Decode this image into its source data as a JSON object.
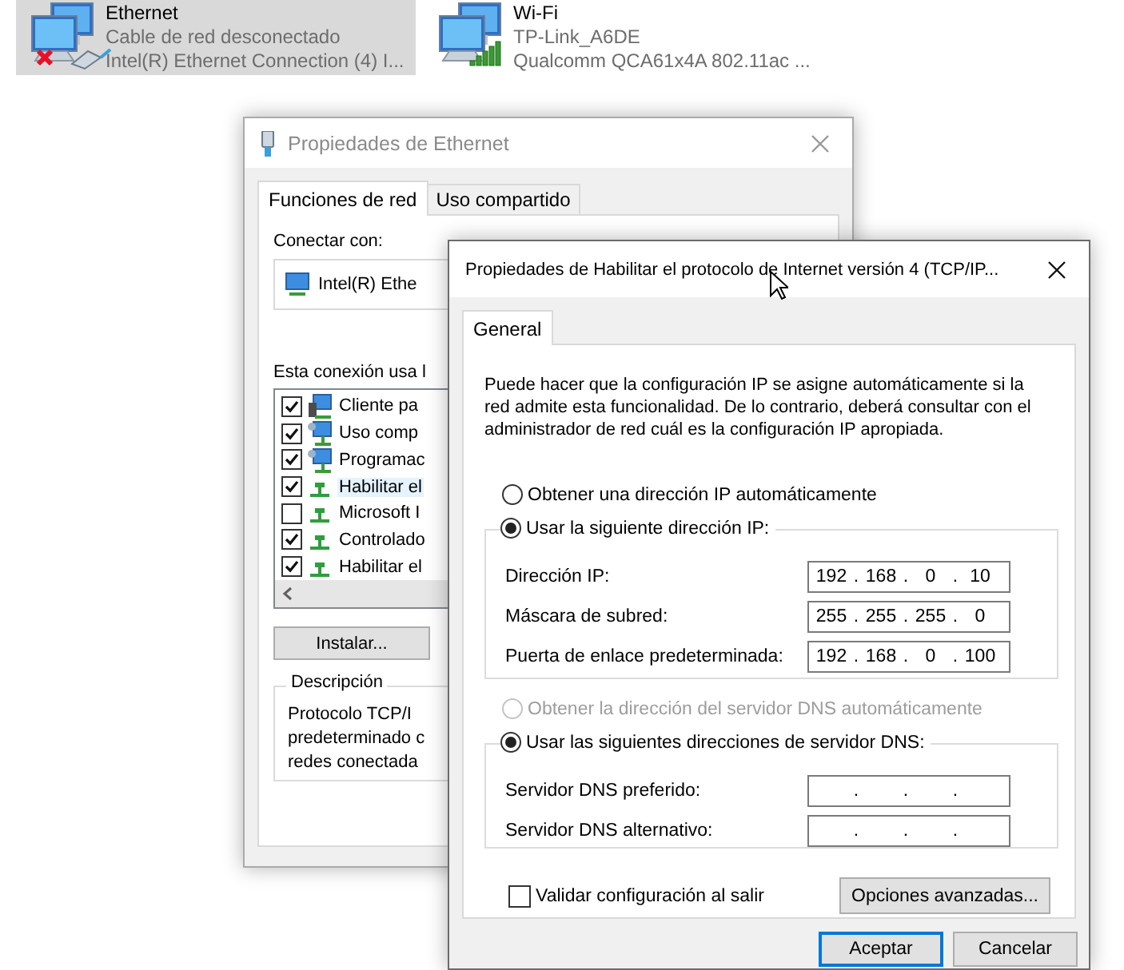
{
  "adapters": [
    {
      "name": "Ethernet",
      "status": "Cable de red desconectado",
      "device": "Intel(R) Ethernet Connection (4) I...",
      "kind": "wired",
      "connected": false,
      "selected": true
    },
    {
      "name": "Wi-Fi",
      "status": "TP-Link_A6DE",
      "device": "Qualcomm QCA61x4A 802.11ac ...",
      "kind": "wireless",
      "connected": true,
      "selected": false
    }
  ],
  "ethernet_window": {
    "title": "Propiedades de Ethernet",
    "tabs": [
      {
        "label": "Funciones de red",
        "selected": true
      },
      {
        "label": "Uso compartido",
        "selected": false
      }
    ],
    "connect_label": "Conectar con:",
    "adapter": "Intel(R) Ethe",
    "items_label": "Esta conexión usa l",
    "items": [
      {
        "label": "Cliente pa",
        "kind": "client",
        "checked": true,
        "selected": false
      },
      {
        "label": "Uso comp",
        "kind": "service",
        "checked": true,
        "selected": false
      },
      {
        "label": "Programac",
        "kind": "service",
        "checked": true,
        "selected": false
      },
      {
        "label": "Habilitar el",
        "kind": "protocol",
        "checked": true,
        "selected": true
      },
      {
        "label": "Microsoft I",
        "kind": "protocol",
        "checked": false,
        "selected": false
      },
      {
        "label": "Controlado",
        "kind": "protocol",
        "checked": true,
        "selected": false
      },
      {
        "label": "Habilitar el",
        "kind": "protocol",
        "checked": true,
        "selected": false
      }
    ],
    "install_button": "Instalar...",
    "description": {
      "legend": "Descripción",
      "lines": [
        "Protocolo TCP/I",
        "predeterminado c",
        "redes conectada"
      ]
    }
  },
  "ipv4_dialog": {
    "title": "Propiedades de Habilitar el protocolo de Internet versión 4 (TCP/IP...",
    "tabs": [
      {
        "label": "General",
        "selected": true
      }
    ],
    "intro": "Puede hacer que la configuración IP se asigne automáticamente si la red admite esta funcionalidad. De lo contrario, deberá consultar con el administrador de red cuál es la configuración IP apropiada.",
    "ip_auto": {
      "label": "Obtener una dirección IP automáticamente",
      "selected": false,
      "disabled": false
    },
    "ip_manual": {
      "label": "Usar la siguiente dirección IP:",
      "selected": true,
      "disabled": false
    },
    "ip_fields": [
      {
        "label": "Dirección IP:",
        "octets": [
          "192",
          "168",
          "0",
          "10"
        ],
        "dots": [
          ".",
          ".",
          "."
        ]
      },
      {
        "label": "Máscara de subred:",
        "octets": [
          "255",
          "255",
          "255",
          "0"
        ],
        "dots": [
          ".",
          ".",
          "."
        ]
      },
      {
        "label": "Puerta de enlace predeterminada:",
        "octets": [
          "192",
          "168",
          "0",
          "100"
        ],
        "dots": [
          ".",
          ".",
          "."
        ]
      }
    ],
    "dns_auto": {
      "label": "Obtener la dirección del servidor DNS automáticamente",
      "selected": false,
      "disabled": true
    },
    "dns_manual": {
      "label": "Usar las siguientes direcciones de servidor DNS:",
      "selected": true,
      "disabled": false
    },
    "dns_fields": [
      {
        "label": "Servidor DNS preferido:",
        "dots": [
          ".",
          ".",
          "."
        ]
      },
      {
        "label": "Servidor DNS alternativo:",
        "dots": [
          ".",
          ".",
          "."
        ]
      }
    ],
    "validate": {
      "label": "Validar configuración al salir",
      "checked": false
    },
    "advanced_button": "Opciones avanzadas...",
    "buttons": [
      {
        "label": "Aceptar",
        "default": true
      },
      {
        "label": "Cancelar",
        "default": false
      }
    ]
  }
}
